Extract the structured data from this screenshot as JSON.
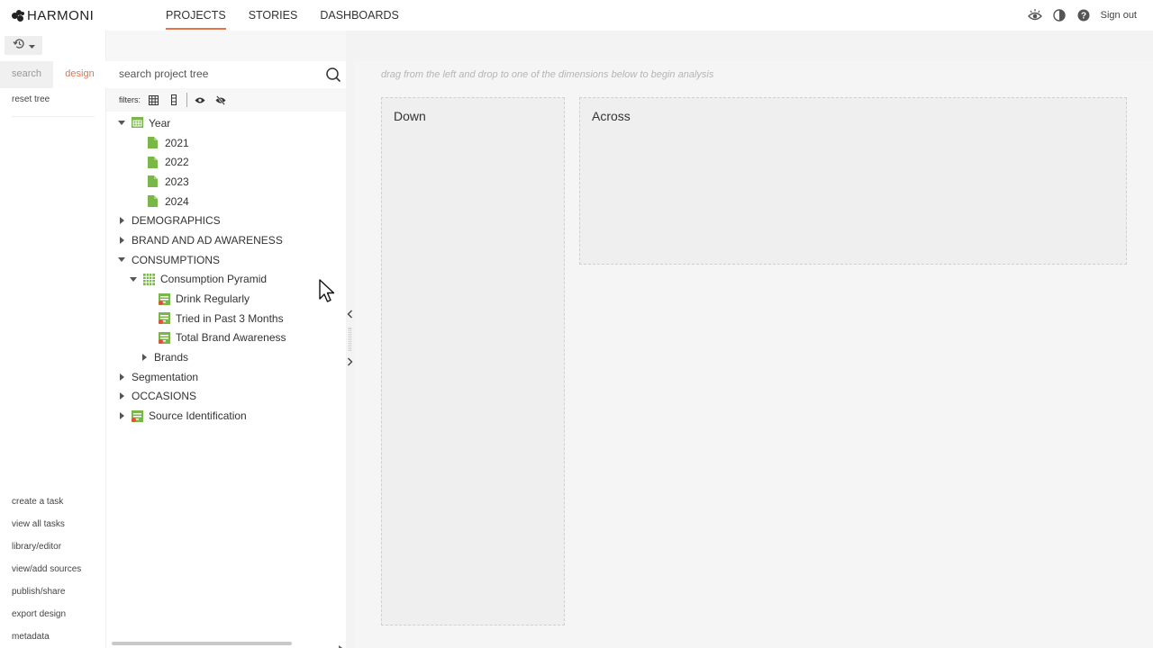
{
  "app": {
    "brand": "HARMONI",
    "accent_color": "#e8734a"
  },
  "nav": {
    "items": [
      {
        "label": "PROJECTS",
        "active": true
      },
      {
        "label": "STORIES",
        "active": false
      },
      {
        "label": "DASHBOARDS",
        "active": false
      }
    ]
  },
  "top_right": {
    "icons": [
      "eye-icon",
      "contrast-icon",
      "help-icon"
    ],
    "signout_label": "Sign out"
  },
  "rail": {
    "history_icon": "history-icon",
    "tabs": [
      {
        "label": "search",
        "active": false
      },
      {
        "label": "design",
        "active": true
      }
    ],
    "reset_tree_label": "reset tree",
    "links": [
      "create a task",
      "view all tasks",
      "library/editor",
      "view/add sources",
      "publish/share",
      "export design",
      "metadata"
    ]
  },
  "tree_panel": {
    "search_placeholder": "search project tree",
    "filters_label": "filters:",
    "nodes": [
      {
        "label": "Year",
        "caret": "down",
        "icon": "calendar-icon"
      },
      {
        "label": "2021",
        "caret": "none",
        "icon": "file-icon"
      },
      {
        "label": "2022",
        "caret": "none",
        "icon": "file-icon"
      },
      {
        "label": "2023",
        "caret": "none",
        "icon": "file-icon"
      },
      {
        "label": "2024",
        "caret": "none",
        "icon": "file-icon"
      },
      {
        "label": "DEMOGRAPHICS",
        "caret": "right",
        "icon": "none"
      },
      {
        "label": "BRAND AND AD AWARENESS",
        "caret": "right",
        "icon": "none"
      },
      {
        "label": "CONSUMPTIONS",
        "caret": "down",
        "icon": "none"
      },
      {
        "label": "Consumption Pyramid",
        "caret": "down",
        "icon": "grid-icon"
      },
      {
        "label": "Drink Regularly",
        "caret": "none",
        "icon": "variable-icon"
      },
      {
        "label": "Tried in Past 3 Months",
        "caret": "none",
        "icon": "variable-icon"
      },
      {
        "label": "Total Brand Awareness",
        "caret": "none",
        "icon": "variable-icon"
      },
      {
        "label": "Brands",
        "caret": "right",
        "icon": "none"
      },
      {
        "label": "Segmentation",
        "caret": "right",
        "icon": "none"
      },
      {
        "label": "OCCASIONS",
        "caret": "right",
        "icon": "none"
      },
      {
        "label": "Source Identification",
        "caret": "right",
        "icon": "variable-icon"
      }
    ]
  },
  "main": {
    "hint": "drag from the left and drop to one of the dimensions below to begin analysis",
    "down_label": "Down",
    "across_label": "Across"
  }
}
